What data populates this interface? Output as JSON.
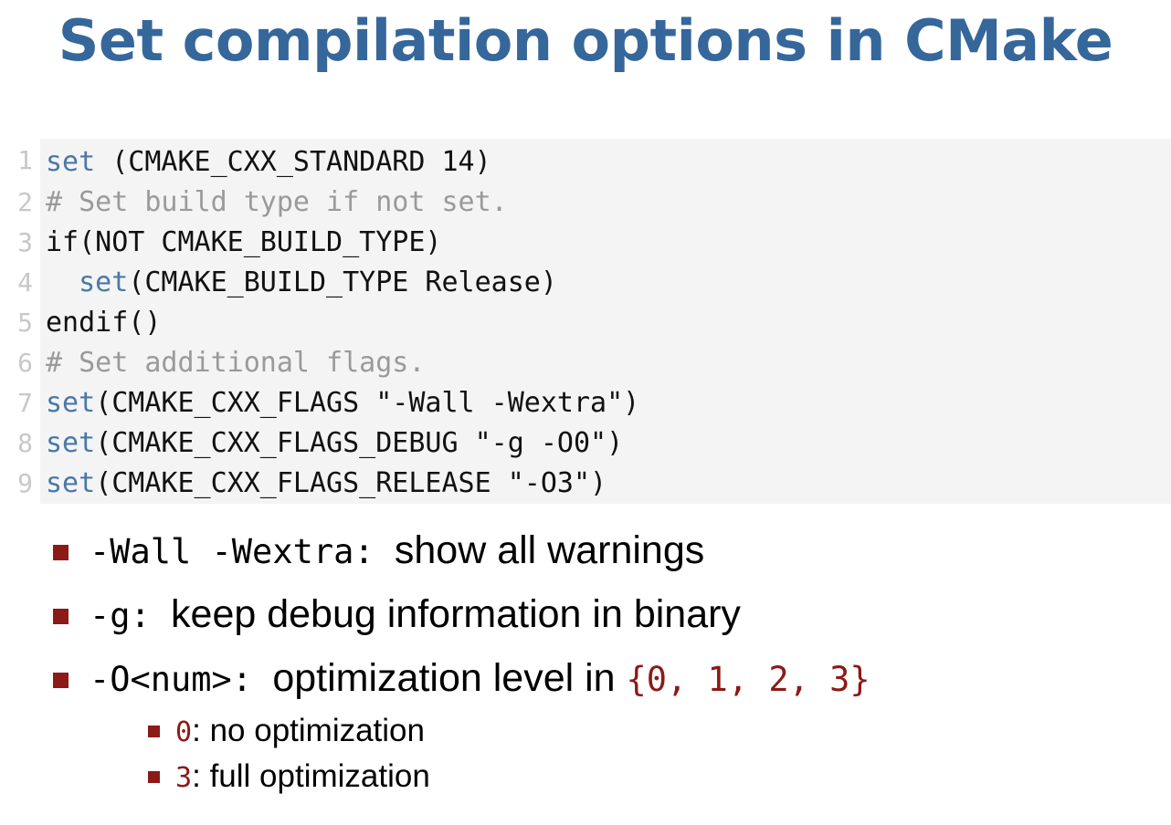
{
  "slide": {
    "title": "Set compilation options in CMake",
    "title_color": "#35679B",
    "background_color": "#ffffff"
  },
  "code_block": {
    "background_color": "#F4F4F4",
    "language": "cmake",
    "keyword_color": "#4A78A6",
    "comment_color": "#9A9A9A",
    "lineno_color": "#C8C8C8",
    "lines": [
      {
        "n": "1",
        "keyword": "set",
        "rest": " (CMAKE_CXX_STANDARD 14)",
        "comment": ""
      },
      {
        "n": "2",
        "keyword": "",
        "rest": "",
        "comment": "# Set build type if not set."
      },
      {
        "n": "3",
        "keyword": "",
        "rest": "if(NOT CMAKE_BUILD_TYPE)",
        "comment": ""
      },
      {
        "n": "4",
        "keyword": "  set",
        "rest": "(CMAKE_BUILD_TYPE Release)",
        "comment": ""
      },
      {
        "n": "5",
        "keyword": "",
        "rest": "endif()",
        "comment": ""
      },
      {
        "n": "6",
        "keyword": "",
        "rest": "",
        "comment": "# Set additional flags."
      },
      {
        "n": "7",
        "keyword": "set",
        "rest": "(CMAKE_CXX_FLAGS \"-Wall -Wextra\")",
        "comment": ""
      },
      {
        "n": "8",
        "keyword": "set",
        "rest": "(CMAKE_CXX_FLAGS_DEBUG \"-g -O0\")",
        "comment": ""
      },
      {
        "n": "9",
        "keyword": "set",
        "rest": "(CMAKE_CXX_FLAGS_RELEASE \"-O3\")",
        "comment": ""
      }
    ]
  },
  "bullets": {
    "marker_color": "#8C1A17",
    "items": [
      {
        "flag": "-Wall -Wextra",
        "separator": ": ",
        "description": "show all warnings",
        "suffix_mono": ""
      },
      {
        "flag": "-g",
        "separator": ": ",
        "description": "keep debug information in binary",
        "suffix_mono": ""
      },
      {
        "flag": "-O<num>",
        "separator": ": ",
        "description": "optimization level in ",
        "suffix_mono": "{0, 1, 2, 3}"
      }
    ],
    "sub_items": [
      {
        "value": "0",
        "separator": ": ",
        "description": "no optimization"
      },
      {
        "value": "3",
        "separator": ": ",
        "description": "full optimization"
      }
    ]
  }
}
